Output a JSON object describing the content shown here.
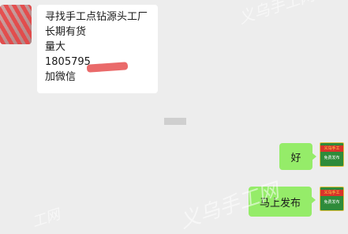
{
  "chat": {
    "incoming": {
      "lines": [
        "寻找手工点钻源头工厂",
        "长期有货",
        "量大",
        "1805795",
        "加微信"
      ]
    },
    "outgoing": [
      {
        "text": "好"
      },
      {
        "text": "马上发布"
      }
    ],
    "sender_avatar_text": {
      "top": "义乌手工",
      "bottom": "免费发布"
    },
    "watermark": [
      "义乌手工网",
      "工网",
      "义乌手工网"
    ]
  }
}
